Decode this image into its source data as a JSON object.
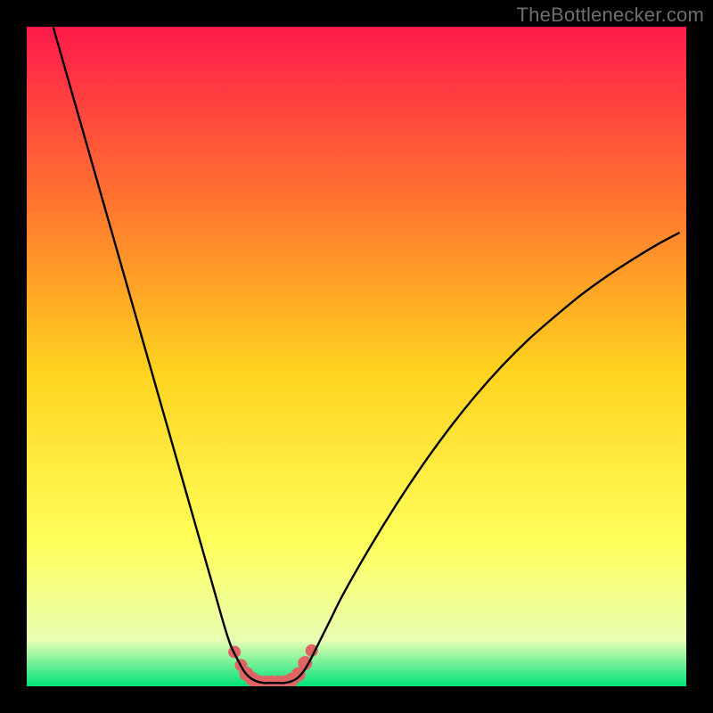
{
  "attribution": "TheBottlenecker.com",
  "colors": {
    "frame_bg": "#000000",
    "gradient_top": "#ff1a4b",
    "gradient_mid_upper": "#ff7a2e",
    "gradient_mid": "#ffd21f",
    "gradient_mid_lower": "#ffff5a",
    "gradient_lower": "#e9ffb3",
    "gradient_bottom": "#00e27a",
    "curve": "#000000",
    "markers": "#e06464"
  },
  "chart_data": {
    "type": "line",
    "title": "",
    "xlabel": "",
    "ylabel": "",
    "xlim": [
      0,
      100
    ],
    "ylim": [
      0,
      100
    ],
    "series": [
      {
        "name": "bottleneck-curve",
        "x": [
          4,
          6,
          8,
          10,
          12,
          14,
          16,
          18,
          20,
          22,
          24,
          26,
          28,
          30,
          31,
          32,
          33,
          34,
          35,
          36,
          37,
          38,
          39,
          40,
          41,
          42,
          43,
          44,
          46,
          48,
          52,
          56,
          60,
          64,
          68,
          72,
          76,
          80,
          84,
          88,
          92,
          96,
          99
        ],
        "y": [
          100,
          93,
          86,
          79,
          72,
          65,
          58,
          51,
          44,
          37,
          30,
          23,
          16,
          9,
          6,
          4,
          2.2,
          1.2,
          0.7,
          0.5,
          0.5,
          0.5,
          0.5,
          0.7,
          1.2,
          2.3,
          4,
          6,
          10,
          14,
          21,
          27.5,
          33.5,
          39,
          44,
          48.5,
          52.5,
          56,
          59.3,
          62.2,
          64.8,
          67.2,
          68.8
        ]
      }
    ],
    "markers": {
      "name": "highlight-dots",
      "x": [
        31.5,
        32.5,
        33.3,
        34.2,
        35.2,
        36.2,
        37.2,
        38.2,
        39.2,
        40.2,
        41.2,
        42.2,
        43.2
      ],
      "y": [
        5.2,
        3.2,
        1.9,
        1.1,
        0.6,
        0.55,
        0.55,
        0.55,
        0.6,
        1.0,
        1.8,
        3.5,
        5.4
      ],
      "r": [
        7,
        7,
        8,
        8,
        8,
        8,
        8,
        8,
        8,
        8,
        8,
        8,
        7
      ]
    }
  }
}
